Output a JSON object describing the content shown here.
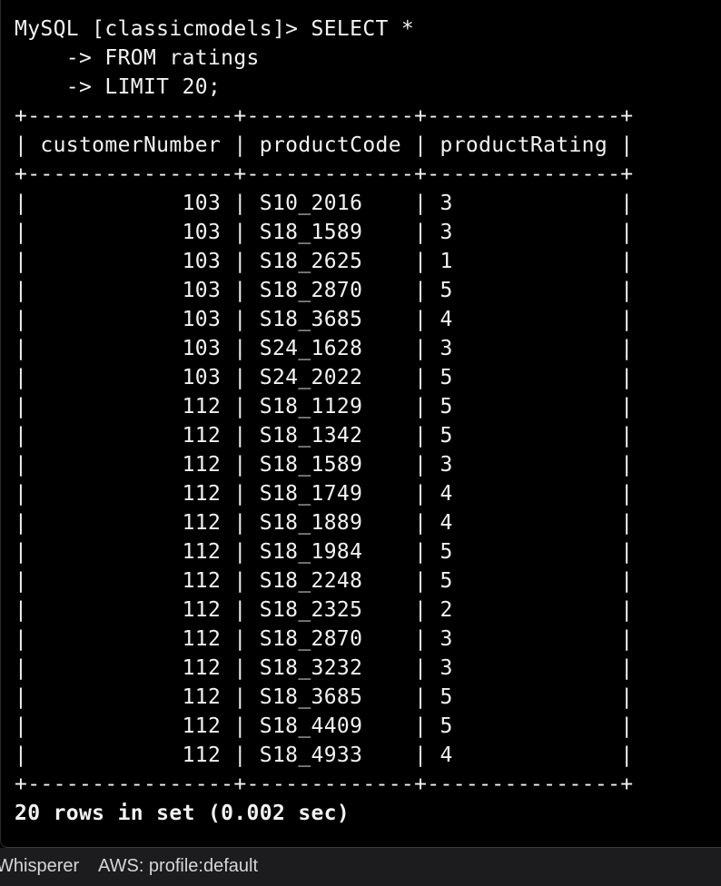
{
  "terminal": {
    "prompt": "MySQL [classicmodels]> SELECT *",
    "continuation_lines": [
      "    -> FROM ratings",
      "    -> LIMIT 20;"
    ],
    "table": {
      "border": "+----------------+-------------+---------------+",
      "headers": [
        "customerNumber",
        "productCode",
        "productRating"
      ],
      "rows": [
        [
          "103",
          "S10_2016",
          "3"
        ],
        [
          "103",
          "S18_1589",
          "3"
        ],
        [
          "103",
          "S18_2625",
          "1"
        ],
        [
          "103",
          "S18_2870",
          "5"
        ],
        [
          "103",
          "S18_3685",
          "4"
        ],
        [
          "103",
          "S24_1628",
          "3"
        ],
        [
          "103",
          "S24_2022",
          "5"
        ],
        [
          "112",
          "S18_1129",
          "5"
        ],
        [
          "112",
          "S18_1342",
          "5"
        ],
        [
          "112",
          "S18_1589",
          "3"
        ],
        [
          "112",
          "S18_1749",
          "4"
        ],
        [
          "112",
          "S18_1889",
          "4"
        ],
        [
          "112",
          "S18_1984",
          "5"
        ],
        [
          "112",
          "S18_2248",
          "5"
        ],
        [
          "112",
          "S18_2325",
          "2"
        ],
        [
          "112",
          "S18_2870",
          "3"
        ],
        [
          "112",
          "S18_3232",
          "3"
        ],
        [
          "112",
          "S18_3685",
          "5"
        ],
        [
          "112",
          "S18_4409",
          "5"
        ],
        [
          "112",
          "S18_4933",
          "4"
        ]
      ]
    },
    "result_summary": "20 rows in set (0.002 sec)"
  },
  "status_bar": {
    "items": [
      "Whisperer",
      "AWS: profile:default"
    ]
  },
  "colors": {
    "background": "#000000",
    "text": "#f2f2f2",
    "status_bar_bg": "#1c1c1e",
    "status_bar_text": "#d6d6d6"
  }
}
